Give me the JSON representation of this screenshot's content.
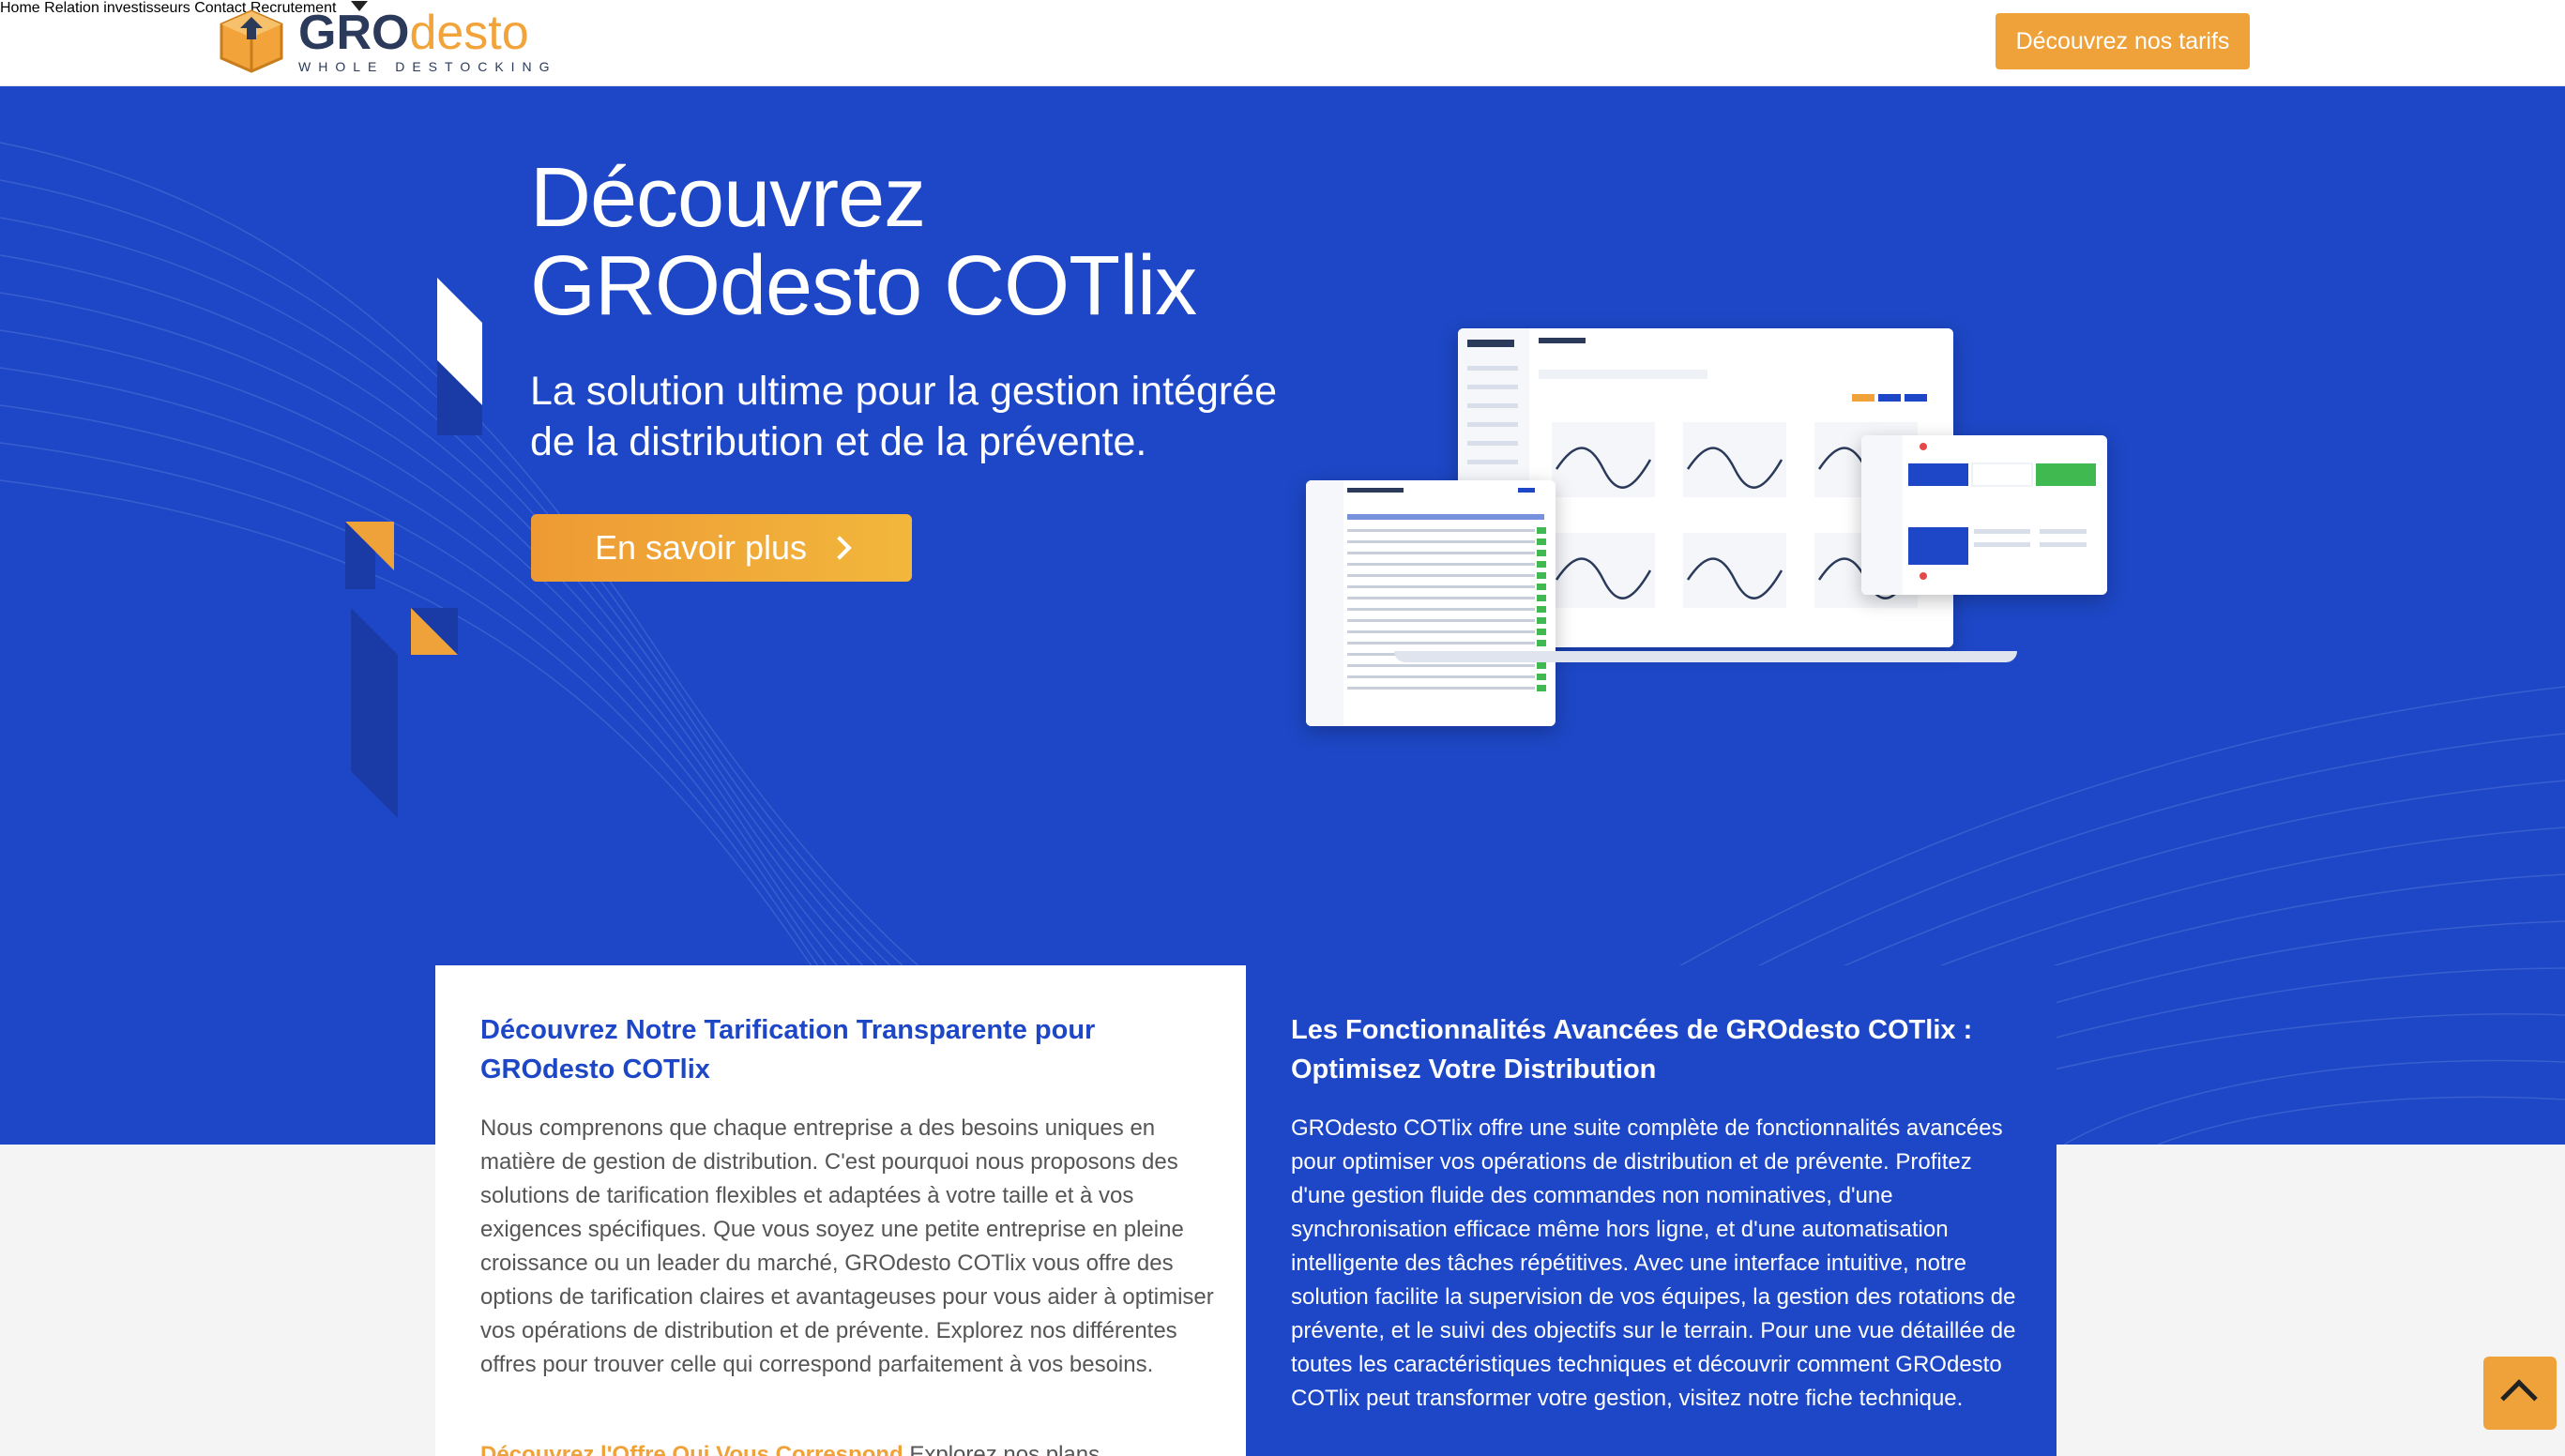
{
  "header": {
    "logo": {
      "name_part1": "GRO",
      "name_part2": "desto",
      "tagline": "WHOLE DESTOCKING"
    },
    "nav": [
      {
        "label": "Home"
      },
      {
        "label": "Relation investisseurs"
      },
      {
        "label": "Contact"
      },
      {
        "label": "Recrutement",
        "has_dropdown": true
      }
    ],
    "cta_label": "Découvrez nos tarifs"
  },
  "hero": {
    "title_line1": "Découvrez",
    "title_line2": "GROdesto COTlix",
    "subtitle_line1": "La solution ultime pour la gestion intégrée",
    "subtitle_line2": "de la distribution et de la prévente.",
    "button_label": "En savoir plus"
  },
  "cards": {
    "pricing": {
      "title": "Découvrez Notre Tarification Transparente pour GROdesto COTlix",
      "body": "Nous comprenons que chaque entreprise a des besoins uniques en matière de gestion de distribution. C'est pourquoi nous proposons des solutions de tarification flexibles et adaptées à votre taille et à vos exigences spécifiques. Que vous soyez une petite entreprise en pleine croissance ou un leader du marché, GROdesto COTlix vous offre des options de tarification claires et avantageuses pour vous aider à optimiser vos opérations de distribution et de prévente. Explorez nos différentes offres pour trouver celle qui correspond parfaitement à vos besoins.",
      "link_label": "Découvrez l'Offre Qui Vous Correspond",
      "link_after": "Explorez nos plans"
    },
    "features": {
      "title": "Les Fonctionnalités Avancées de GROdesto COTlix : Optimisez Votre Distribution",
      "body": "GROdesto COTlix offre une suite complète de fonctionnalités avancées pour optimiser vos opérations de distribution et de prévente. Profitez d'une gestion fluide des commandes non nominatives, d'une synchronisation efficace même hors ligne, et d'une automatisation intelligente des tâches répétitives. Avec une interface intuitive, notre solution facilite la supervision de vos équipes, la gestion des rotations de prévente, et le suivi des objectifs sur le terrain. Pour une vue détaillée de toutes les caractéristiques techniques et découvrir comment GROdesto COTlix peut transformer votre gestion, visitez notre fiche technique."
    }
  },
  "colors": {
    "brand_blue": "#1d47c6",
    "brand_orange": "#f0a23a",
    "logo_navy": "#2b3a5a"
  },
  "icons": {
    "dropdown": "caret-down-icon",
    "button_arrow": "chevron-right-icon",
    "back_to_top": "chevron-up-icon"
  }
}
